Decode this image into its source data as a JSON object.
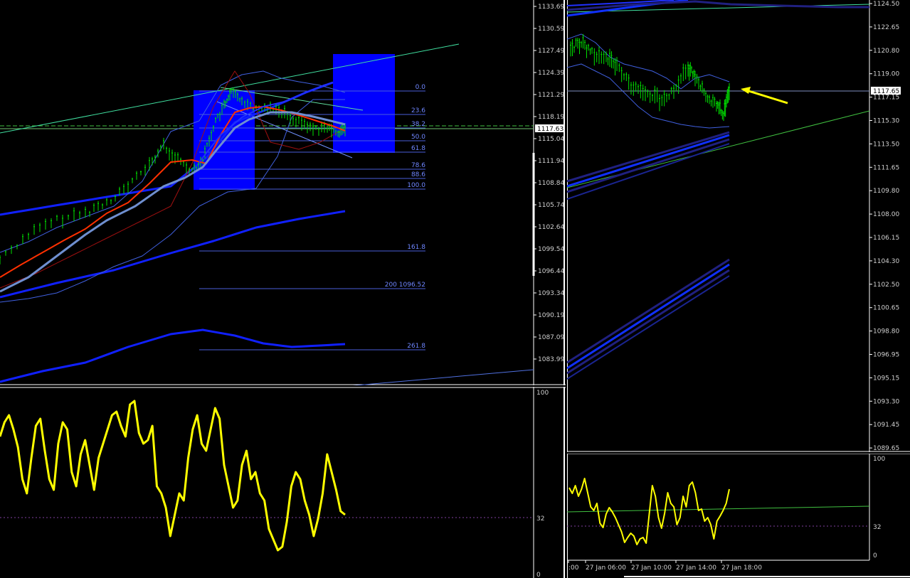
{
  "left_chart": {
    "price_axis": [
      "1133.69",
      "1130.59",
      "1127.49",
      "1124.39",
      "1121.29",
      "1118.19",
      "1115.04",
      "1111.94",
      "1108.84",
      "1105.74",
      "1102.64",
      "1099.54",
      "1096.44",
      "1093.34",
      "1090.19",
      "1087.09",
      "1083.99"
    ],
    "current_price": "1117.63",
    "fib_levels": [
      "0.0",
      "23.6",
      "38.2",
      "50.0",
      "61.8",
      "78.6",
      "88.6",
      "100.0",
      "161.8",
      "200 1096.52",
      "261.8"
    ],
    "osc_axis": [
      "100",
      "32",
      "0"
    ]
  },
  "right_chart": {
    "price_axis": [
      "1124.50",
      "1122.65",
      "1120.80",
      "1119.00",
      "1117.15",
      "1115.30",
      "1113.50",
      "1111.65",
      "1109.80",
      "1108.00",
      "1106.15",
      "1104.30",
      "1102.50",
      "1100.65",
      "1098.80",
      "1096.95",
      "1095.15",
      "1093.30",
      "1091.45",
      "1089.65"
    ],
    "current_price": "1117.65",
    "osc_axis": [
      "100",
      "32",
      "0"
    ],
    "time_axis": [
      ":00",
      "27 Jan 06:00",
      "27 Jan 10:00",
      "27 Jan 14:00",
      "27 Jan 18:00"
    ]
  },
  "colors": {
    "candle": "#00e000",
    "ma_blue": "#1020ff",
    "ma_red": "#ff3000",
    "ma_steel": "#6f8fd0",
    "bollinger": "#4060e0",
    "trendline": "#40e0a0",
    "oscillator": "#ffff00",
    "arrow": "#ffff00",
    "rect_fill": "#0000ff"
  }
}
